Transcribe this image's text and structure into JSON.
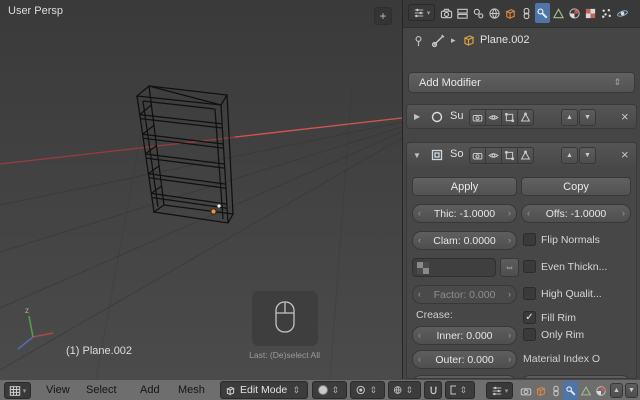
{
  "glyphs": {
    "expand_collapsed": "▶",
    "expand_open": "▼",
    "close": "×",
    "move_up": "▲",
    "move_down": "▼",
    "select_updown": "⇕",
    "num_prev": "‹",
    "num_next": "›",
    "swap": "⇔",
    "check": "✓",
    "breadcrumb_sep": "▸",
    "dropdown": "▾",
    "plus": "+"
  },
  "viewport": {
    "view_label": "User Persp",
    "object_label": "(1) Plane.002",
    "last_action_label": "Last: (De)select All",
    "axis_z_label": "z"
  },
  "properties": {
    "breadcrumb_object": "Plane.002",
    "add_modifier_label": "Add Modifier",
    "modifier_su_name": "Su",
    "modifier_so_name": "So",
    "apply_label": "Apply",
    "copy_label": "Copy",
    "fields": {
      "thickness": "Thic: -1.0000",
      "offset": "Offs: -1.0000",
      "clamp": "Clam: 0.0000",
      "factor": "Factor: 0.000",
      "inner": "Inner: 0.000",
      "outer": "Outer: 0.000"
    },
    "checks": {
      "flip_normals": "Flip Normals",
      "even_thickness": "Even Thickn...",
      "high_quality": "High Qualit...",
      "fill_rim": "Fill Rim",
      "only_rim": "Only Rim"
    },
    "crease_label": "Crease:",
    "material_index_label": "Material Index O"
  },
  "bottom_bar": {
    "menu_view": "View",
    "menu_select": "Select",
    "menu_add": "Add",
    "menu_mesh": "Mesh",
    "mode_label": "Edit Mode"
  },
  "colors": {
    "active_tab": "#4e74a8",
    "axis_x": "#a94444",
    "origin_dot": "#ef9340"
  }
}
